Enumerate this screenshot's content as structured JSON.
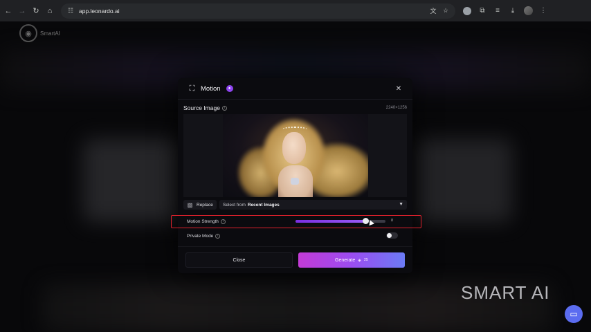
{
  "browser": {
    "url": "app.leonardo.ai"
  },
  "background": {
    "brand_name": "SmartAI",
    "watermark": "SMART AI"
  },
  "modal": {
    "title": "Motion",
    "source_label": "Source Image",
    "image_dimensions": "2240×1256",
    "replace_label": "Replace",
    "select_prefix": "Select from",
    "select_strong": "Recent Images",
    "motion_strength_label": "Motion Strength",
    "motion_strength_value": "8",
    "motion_strength_fraction": 0.78,
    "private_mode_label": "Private Mode",
    "private_mode_on": false,
    "close_label": "Close",
    "generate_label": "Generate",
    "generate_cost": "25"
  },
  "colors": {
    "accent_start": "#c33bd6",
    "accent_end": "#6b7bf5",
    "slider_fill": "#7a2ee0",
    "highlight": "#e0202c",
    "premium": "#8e44f0"
  }
}
